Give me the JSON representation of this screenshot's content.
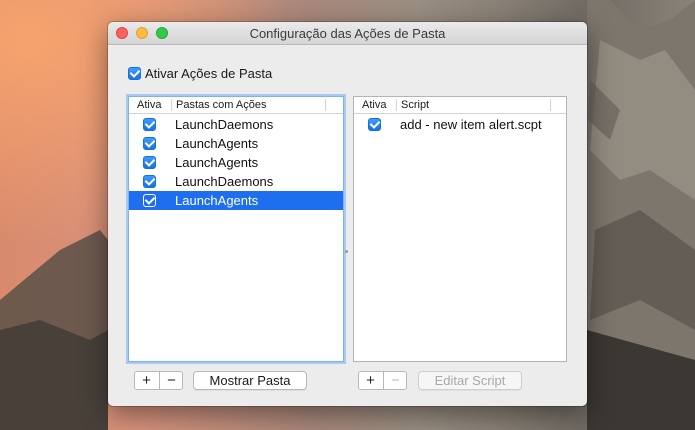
{
  "window": {
    "title": "Configuração das Ações de Pasta"
  },
  "enable": {
    "label": "Ativar Ações de Pasta",
    "checked": true
  },
  "folders": {
    "headers": [
      "Ativa",
      "Pastas com Ações"
    ],
    "rows": [
      {
        "label": "LaunchDaemons",
        "checked": true,
        "selected": false
      },
      {
        "label": "LaunchAgents",
        "checked": true,
        "selected": false
      },
      {
        "label": "LaunchAgents",
        "checked": true,
        "selected": false
      },
      {
        "label": "LaunchDaemons",
        "checked": true,
        "selected": false
      },
      {
        "label": "LaunchAgents",
        "checked": true,
        "selected": true
      }
    ],
    "add_label": "+",
    "remove_label": "−",
    "show_label": "Mostrar Pasta"
  },
  "scripts": {
    "headers": [
      "Ativa",
      "Script"
    ],
    "rows": [
      {
        "label": "add - new item alert.scpt",
        "checked": true,
        "selected": false
      }
    ],
    "add_label": "+",
    "remove_label": "−",
    "edit_label": "Editar Script"
  },
  "colors": {
    "selection": "#1e6ff0",
    "checkbox": "#1473e6",
    "window_bg": "#ececec"
  },
  "icons": [
    "close-icon",
    "minimize-icon",
    "zoom-icon",
    "checkmark-icon"
  ]
}
